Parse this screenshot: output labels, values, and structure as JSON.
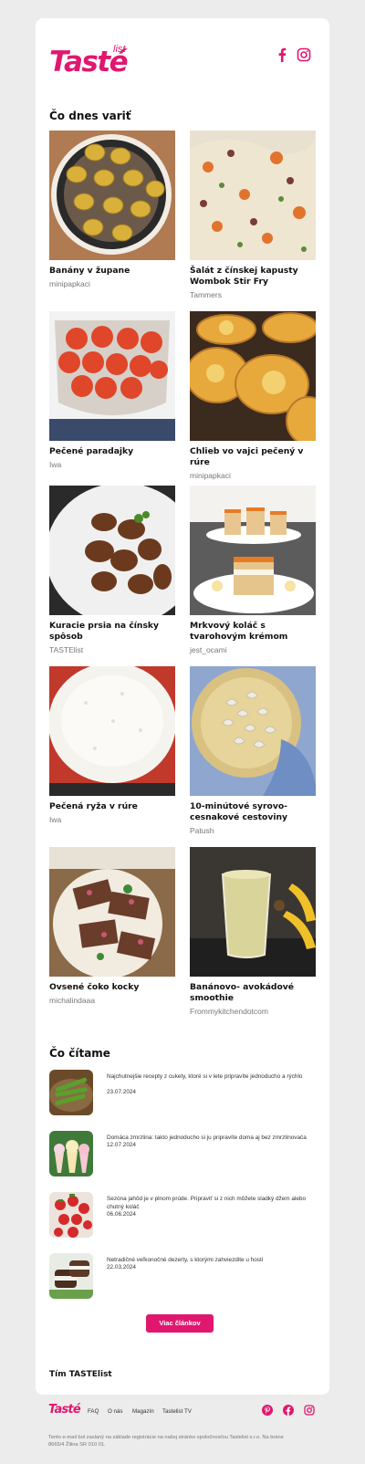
{
  "brand": {
    "logo_word": "Tasté",
    "logo_tag": "list",
    "accent": "#e0176f"
  },
  "header": {
    "social": [
      "facebook-icon",
      "instagram-icon"
    ]
  },
  "cook_section": {
    "title": "Čo dnes variť",
    "recipes": [
      {
        "title": "Banány v župane",
        "author": "minipapkaci"
      },
      {
        "title": "Šalát z čínskej kapusty Wombok Stir Fry",
        "author": "Tammers"
      },
      {
        "title": "Pečené paradajky",
        "author": "Iwa"
      },
      {
        "title": "Chlieb vo vajci pečený v rúre",
        "author": "minipapkaci"
      },
      {
        "title": "Kuracie prsia na čínsky spôsob",
        "author": "TASTElist"
      },
      {
        "title": "Mrkvový koláč s tvarohovým krémom",
        "author": "jest_ocami"
      },
      {
        "title": "Pečená ryža v rúre",
        "author": "Iwa"
      },
      {
        "title": "10-minútové syrovo-cesnakové cestoviny",
        "author": "Patush"
      },
      {
        "title": "Ovsené čoko kocky",
        "author": "michalindaaa"
      },
      {
        "title": "Banánovo- avokádové smoothie",
        "author": "Frommykitchendotcom"
      }
    ]
  },
  "read_section": {
    "title": "Čo čítame",
    "articles": [
      {
        "headline": "Najchutnejšie recepty z cukety, ktoré si v lete pripravíte jednoducho a rýchlo",
        "date": "23.07.2024"
      },
      {
        "headline": "Domáca zmrzlina: takto jednoducho si ju pripravíte doma aj bez zmrzlinovača",
        "date": "12.07.2024"
      },
      {
        "headline": "Sezóna jahôd je v plnom prúde. Pripraviť si z nich môžete sladký džem alebo chutný koláč",
        "date": "06.06.2024"
      },
      {
        "headline": "Netradičné veľkonočné dezerty, s ktorými zahviezdite u hostí",
        "date": "22.03.2024"
      }
    ],
    "more_button": "Viac článkov"
  },
  "signature": "Tím TASTElist",
  "footer": {
    "logo_word": "Tasté",
    "nav": [
      "FAQ",
      "O nás",
      "Magazín",
      "Tastelist TV"
    ],
    "social": [
      "pinterest-icon",
      "facebook-icon",
      "instagram-icon"
    ],
    "note": "Tento e-mail bol zaslaný na základe registrácie na našej stránke spoločnosťou Tastelist s.r.o. Na bráne 8665/4 Žilina SR 010 01."
  }
}
